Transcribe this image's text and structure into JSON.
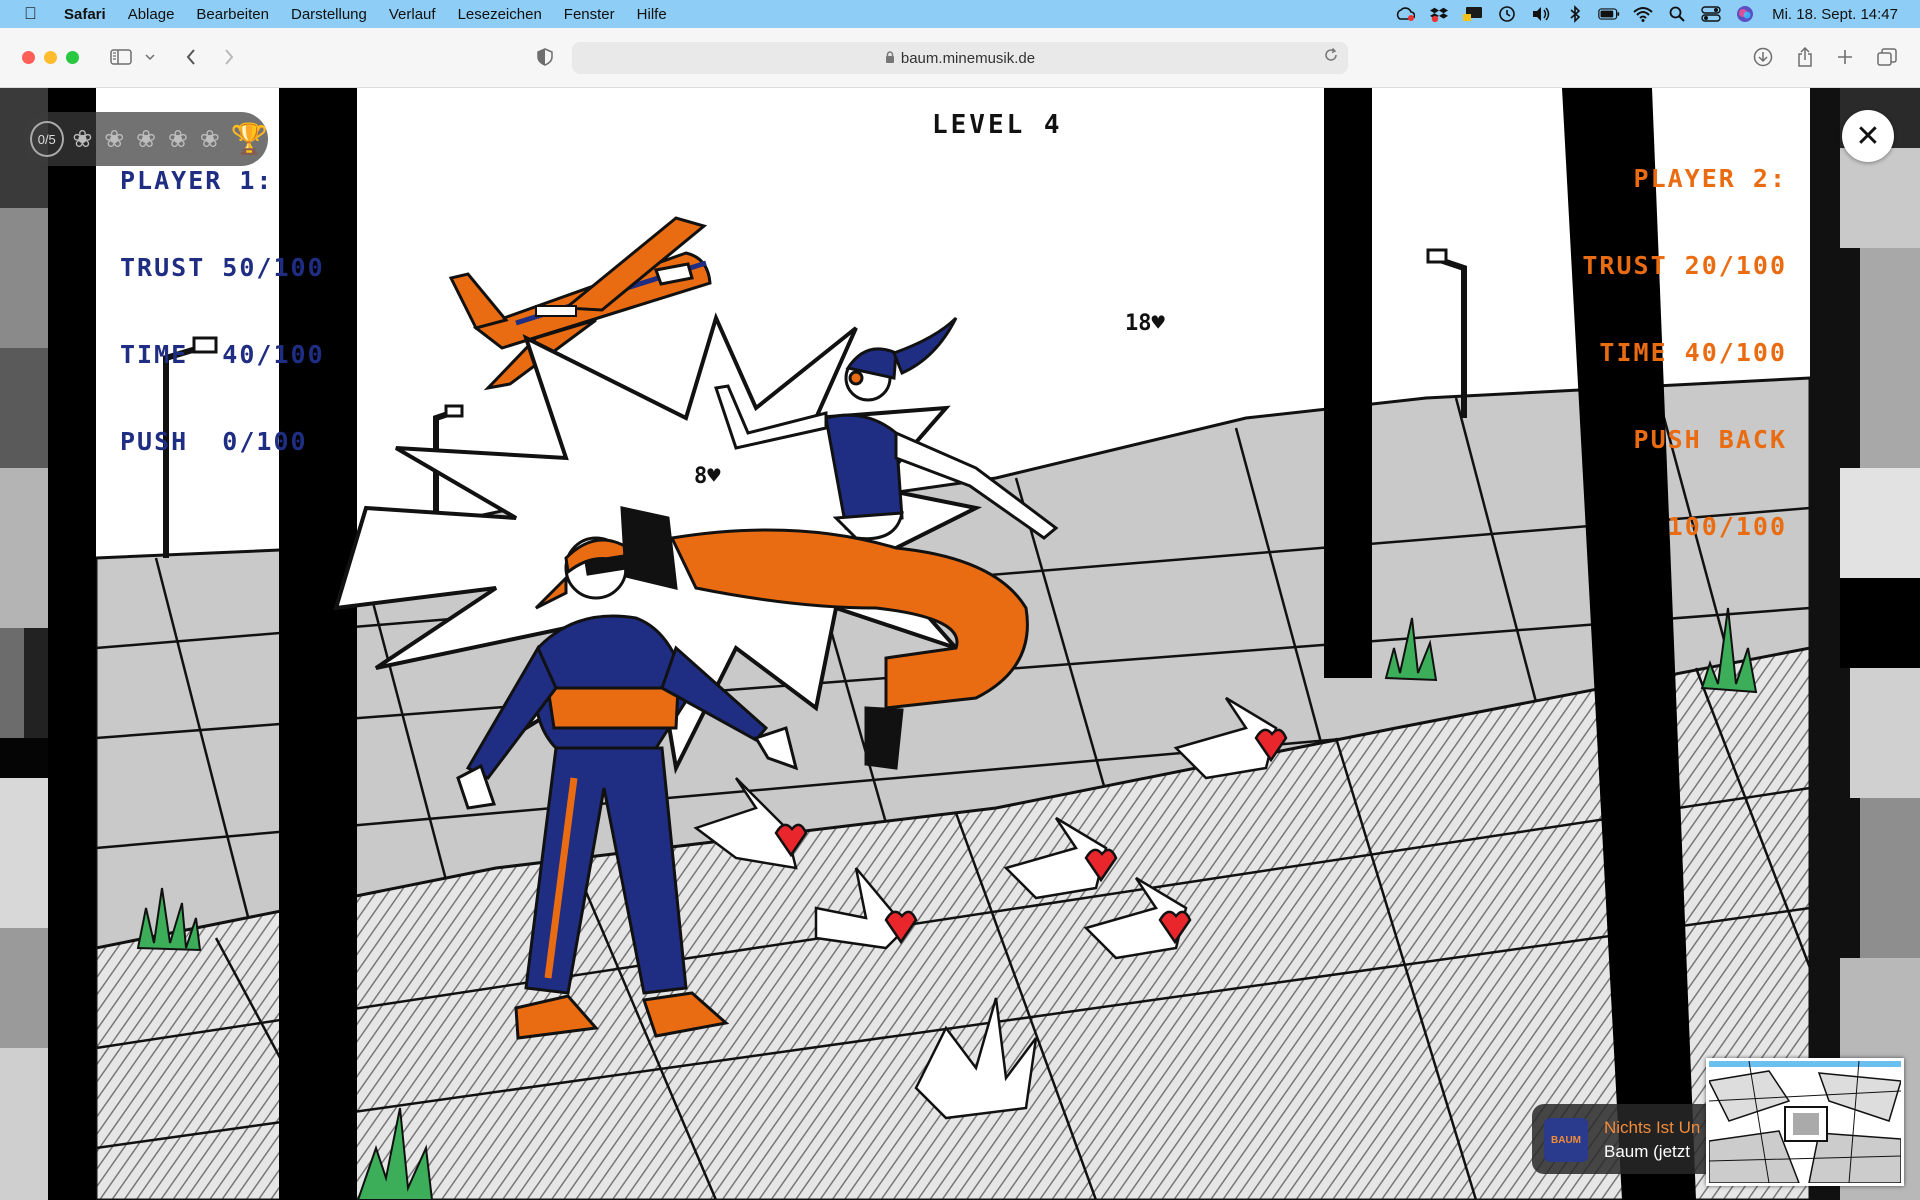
{
  "menubar": {
    "app": "Safari",
    "items": [
      "Ablage",
      "Bearbeiten",
      "Darstellung",
      "Verlauf",
      "Lesezeichen",
      "Fenster",
      "Hilfe"
    ],
    "status_icons": [
      "creative-cloud-icon",
      "dropbox-icon",
      "cast-icon",
      "time-machine-icon",
      "volume-icon",
      "bluetooth-icon",
      "battery-icon",
      "wifi-icon",
      "spotlight-icon",
      "control-center-icon",
      "siri-icon"
    ],
    "clock": "Mi. 18. Sept.  14:47"
  },
  "toolbar": {
    "url": "baum.minemusik.de"
  },
  "game": {
    "player1": {
      "title": "PLAYER 1:",
      "trust": "TRUST 50/100",
      "time": "TIME  40/100",
      "push": "PUSH  0/100"
    },
    "player2": {
      "title": "PLAYER 2:",
      "trust": "TRUST 20/100",
      "time": "TIME 40/100",
      "push": "PUSH BACK",
      "push_value": "100/100"
    },
    "level": "LEVEL 4",
    "hp_player1": "8",
    "hp_player2": "18",
    "colors": {
      "player1": "#1f2d82",
      "player2": "#ea6c12",
      "ground": "#c9c9c9",
      "grass": "#3cae5a",
      "heart": "#e8262c"
    }
  },
  "overlay": {
    "progress_count": "0/5",
    "progress_done": 0,
    "progress_total": 5
  },
  "now_playing": {
    "cover_label": "BAUM",
    "title": "Nichts Ist Un",
    "subtitle": "Baum (jetzt"
  }
}
